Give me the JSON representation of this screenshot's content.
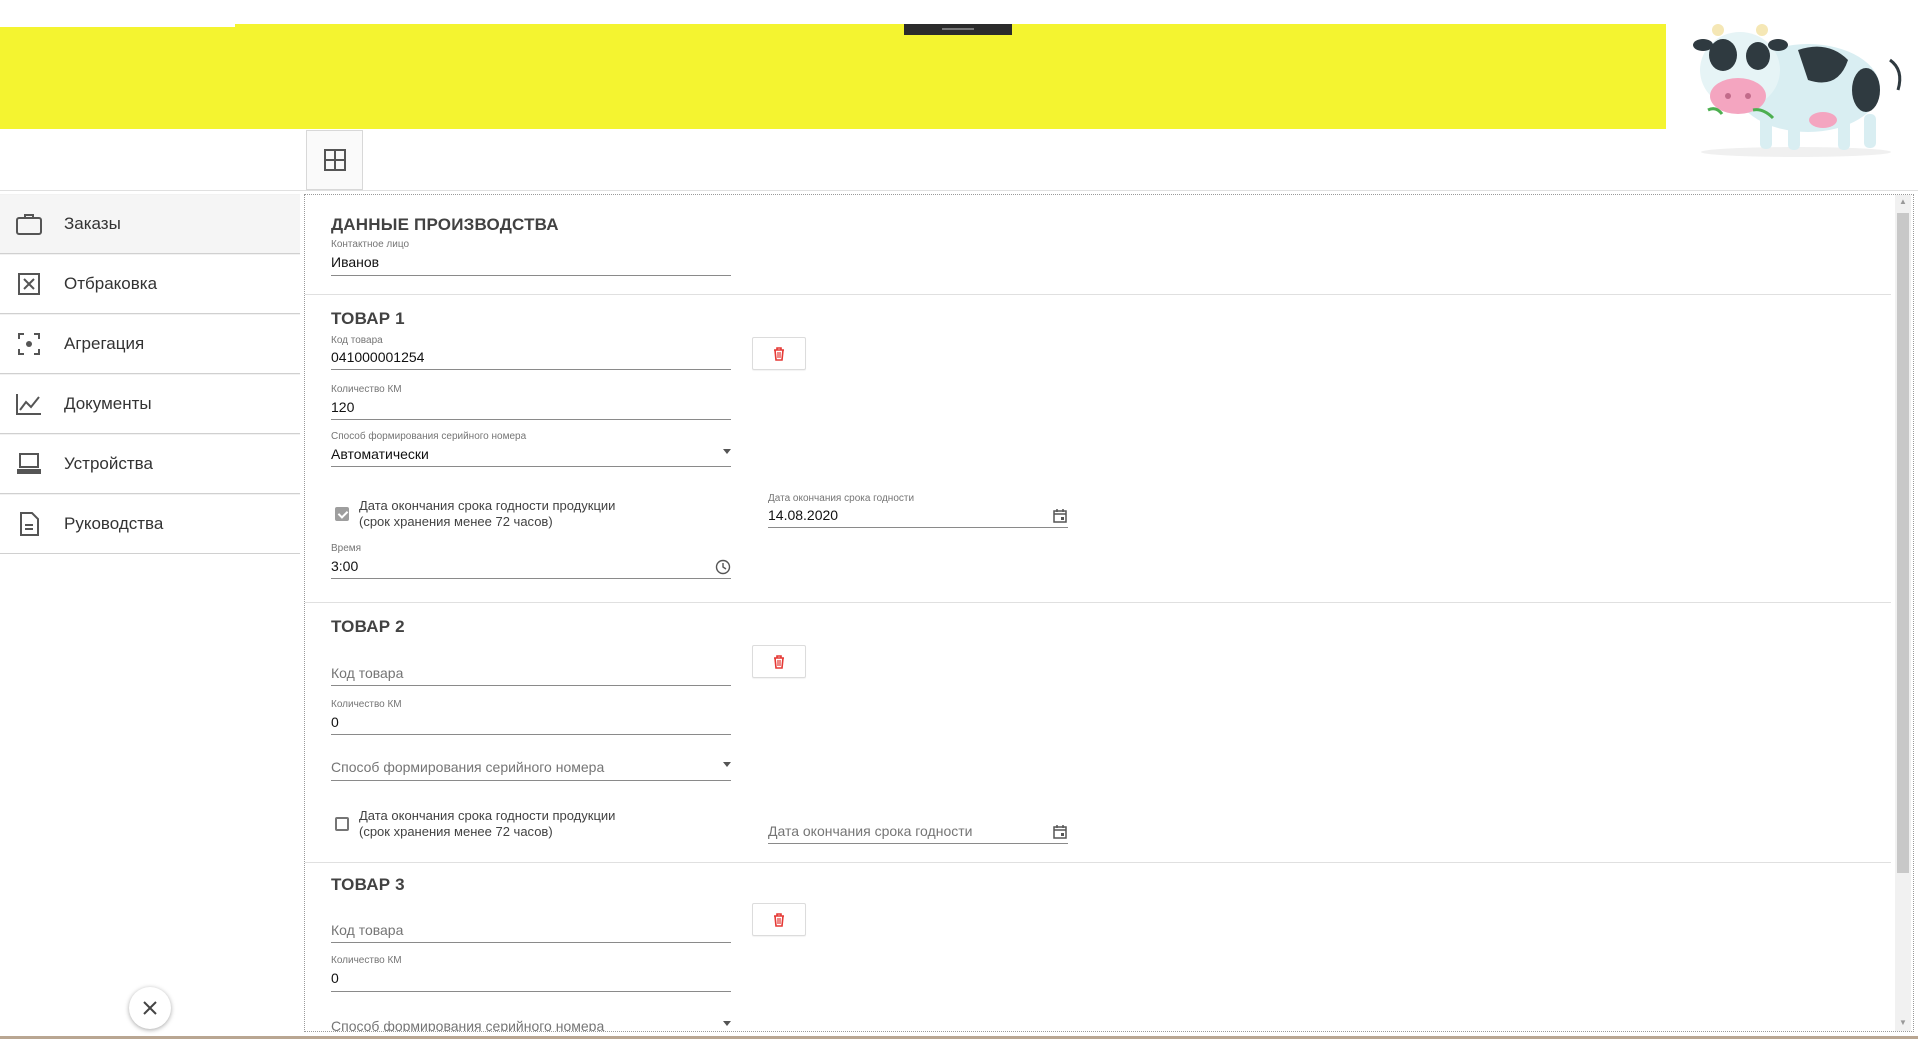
{
  "sidebar": {
    "items": [
      {
        "label": "Заказы",
        "icon": "briefcase-icon"
      },
      {
        "label": "Отбраковка",
        "icon": "x-box-icon"
      },
      {
        "label": "Агрегация",
        "icon": "focus-icon"
      },
      {
        "label": "Документы",
        "icon": "chart-line-icon"
      },
      {
        "label": "Устройства",
        "icon": "laptop-icon"
      },
      {
        "label": "Руководства",
        "icon": "document-icon"
      }
    ]
  },
  "production": {
    "title": "ДАННЫЕ ПРОИЗВОДСТВА",
    "contact_label": "Контактное лицо",
    "contact_value": "Иванов"
  },
  "products": [
    {
      "title": "ТОВАР 1",
      "code_label": "Код товара",
      "code_value": "041000001254",
      "qty_label": "Количество КМ",
      "qty_value": "120",
      "serial_label": "Способ формирования серийного номера",
      "serial_value": "Автоматически",
      "expiry_check_line1": "Дата окончания срока годности продукции",
      "expiry_check_line2": "(срок хранения менее 72 часов)",
      "expiry_checked": true,
      "expiry_label": "Дата окончания срока годности",
      "expiry_value": "14.08.2020",
      "time_label": "Время",
      "time_value": "3:00"
    },
    {
      "title": "ТОВАР 2",
      "code_placeholder": "Код товара",
      "qty_label": "Количество КМ",
      "qty_value": "0",
      "serial_placeholder": "Способ формирования серийного номера",
      "expiry_check_line1": "Дата окончания срока годности продукции",
      "expiry_check_line2": "(срок хранения менее 72 часов)",
      "expiry_checked": false,
      "expiry_placeholder": "Дата окончания срока годности"
    },
    {
      "title": "ТОВАР 3",
      "code_placeholder": "Код товара",
      "qty_label": "Количество КМ",
      "qty_value": "0",
      "serial_placeholder": "Способ формирования серийного номера"
    }
  ],
  "colors": {
    "header_band": "#f4f430",
    "delete_icon": "#e53935"
  }
}
